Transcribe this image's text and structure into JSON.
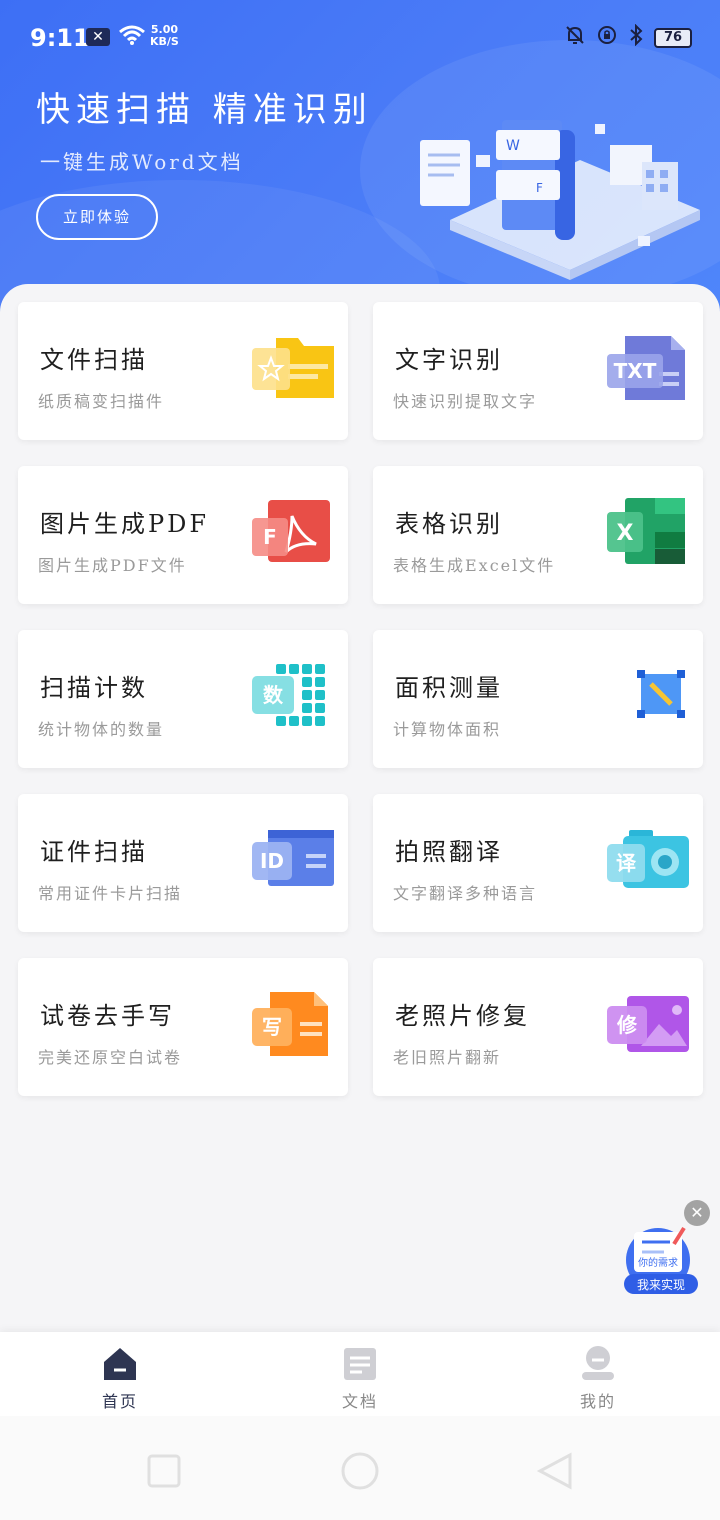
{
  "status_bar": {
    "time": "9:11",
    "notification_badge": "✕",
    "net_speed_value": "5.00",
    "net_speed_unit": "KB/S",
    "battery": "76"
  },
  "hero": {
    "title": "快速扫描 精准识别",
    "subtitle": "一键生成Word文档",
    "cta_label": "立即体验",
    "illustration_letters": [
      "W",
      "F"
    ]
  },
  "features": [
    {
      "title": "文件扫描",
      "desc": "纸质稿变扫描件",
      "icon": "folder-star-icon",
      "badge": ""
    },
    {
      "title": "文字识别",
      "desc": "快速识别提取文字",
      "icon": "txt-file-icon",
      "badge": "TXT"
    },
    {
      "title": "图片生成PDF",
      "desc": "图片生成PDF文件",
      "icon": "pdf-file-icon",
      "badge": "F"
    },
    {
      "title": "表格识别",
      "desc": "表格生成Excel文件",
      "icon": "excel-file-icon",
      "badge": "X"
    },
    {
      "title": "扫描计数",
      "desc": "统计物体的数量",
      "icon": "grid-count-icon",
      "badge": "数"
    },
    {
      "title": "面积测量",
      "desc": "计算物体面积",
      "icon": "area-measure-icon",
      "badge": ""
    },
    {
      "title": "证件扫描",
      "desc": "常用证件卡片扫描",
      "icon": "id-card-icon",
      "badge": "ID"
    },
    {
      "title": "拍照翻译",
      "desc": "文字翻译多种语言",
      "icon": "camera-translate-icon",
      "badge": "译"
    },
    {
      "title": "试卷去手写",
      "desc": "完美还原空白试卷",
      "icon": "exam-paper-icon",
      "badge": "写"
    },
    {
      "title": "老照片修复",
      "desc": "老旧照片翻新",
      "icon": "photo-repair-icon",
      "badge": "修"
    }
  ],
  "promo": {
    "line1": "你的需求",
    "line2": "我来实现",
    "close_icon": "close-icon"
  },
  "bottom_nav": [
    {
      "label": "首页",
      "icon": "home-icon"
    },
    {
      "label": "文档",
      "icon": "document-icon"
    },
    {
      "label": "我的",
      "icon": "profile-icon"
    }
  ],
  "colors": {
    "hero_start": "#3d6ff5",
    "hero_end": "#4f86fb",
    "nav_active": "#2e3552",
    "nav_inactive": "#888888"
  }
}
